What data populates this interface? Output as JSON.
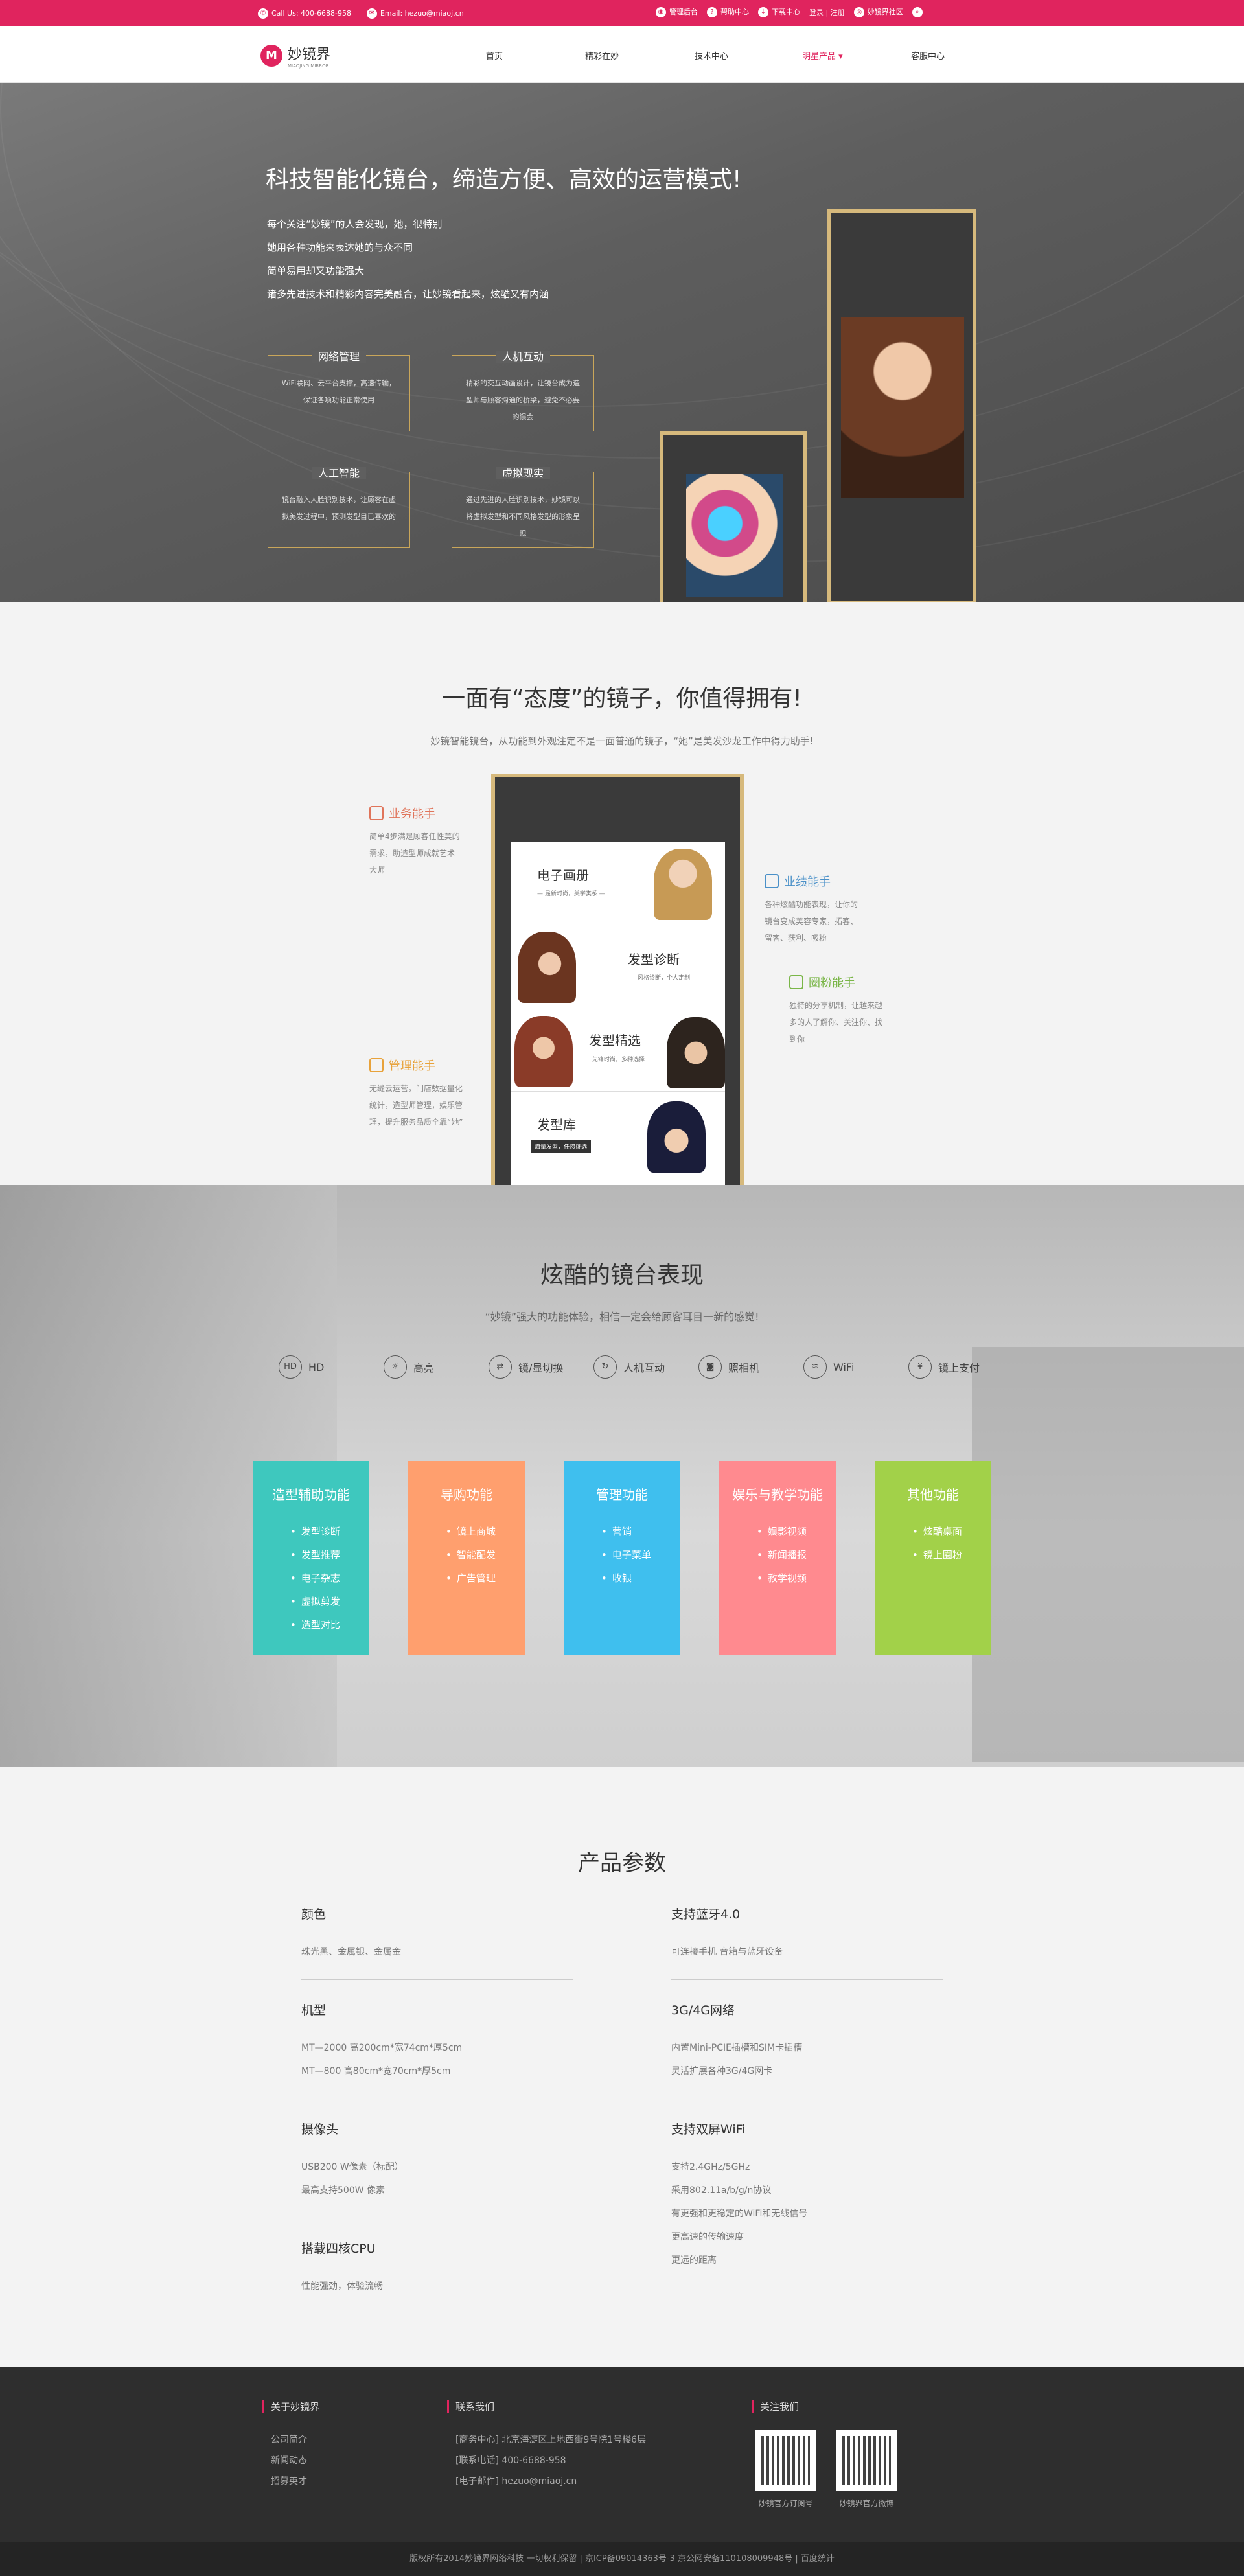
{
  "topbar": {
    "tel": "Call Us: 400-6688-958",
    "email": "Email: hezuo@miaoj.cn",
    "links": [
      "管理后台",
      "帮助中心",
      "下载中心",
      "登录 | 注册",
      "妙镜界社区"
    ],
    "search_icon": "search-icon"
  },
  "nav": {
    "logo_name": "妙镜界",
    "logo_sub": "MIAOJING MIRROR",
    "items": [
      "首页",
      "精彩在妙",
      "技术中心",
      "明星产品 ▾",
      "客服中心"
    ]
  },
  "hero": {
    "title": "科技智能化镜台，缔造方便、高效的运营模式!",
    "desc": [
      "每个关注“妙镜”的人会发现，她，很特别",
      "她用各种功能来表达她的与众不同",
      "简单易用却又功能强大",
      "诸多先进技术和精彩内容完美融合，让妙镜看起来，炫酷又有内涵"
    ],
    "boxes": [
      {
        "title": "网络管理",
        "text": "WiFi联网、云平台支撑，高速传输，保证各项功能正常使用"
      },
      {
        "title": "人机互动",
        "text": "精彩的交互动画设计，让镜台成为造型师与顾客沟通的桥梁，避免不必要的误会"
      },
      {
        "title": "人工智能",
        "text": "镜台融入人脸识别技术，让顾客在虚拟美发过程中，预测发型目已喜欢的"
      },
      {
        "title": "虚拟现实",
        "text": "通过先进的人脸识别技术，妙镜可以将虚拟发型和不同风格发型的形象呈现"
      }
    ]
  },
  "sec2": {
    "title": "一面有“态度”的镜子，你值得拥有!",
    "sub": "妙镜智能镜台，从功能到外观注定不是一面普通的镜子，“她”是美发沙龙工作中得力助手!",
    "panels": [
      {
        "title": "电子画册",
        "sub": "— 最新时尚，美学类系 —"
      },
      {
        "title": "发型诊断",
        "sub": "风格诊断，个人定制"
      },
      {
        "title": "发型精选",
        "sub": "先锋时尚，多种选择"
      },
      {
        "title": "发型库",
        "sub": "海量发型，任您挑选"
      }
    ],
    "features": [
      {
        "title": "业务能手",
        "text": "简单4步满足顾客任性美的需求，助造型师成就艺术大师",
        "color": "#e0745a"
      },
      {
        "title": "业绩能手",
        "text": "各种炫酷功能表现，让你的镜台变成美容专家，拓客、留客、获利、吸粉",
        "color": "#4a90c8"
      },
      {
        "title": "圈粉能手",
        "text": "独特的分享机制，让越来越多的人了解你、关注你、找到你",
        "color": "#7ab648"
      },
      {
        "title": "管理能手",
        "text": "无缝云运营，门店数据量化统计，造型师管理，娱乐管理，提升服务品质全靠“她”",
        "color": "#e8a23a"
      }
    ]
  },
  "sec3": {
    "title": "炫酷的镜台表现",
    "sub": "“妙镜”强大的功能体验，相信一定会给顾客耳目一新的感觉!",
    "icons": [
      {
        "glyph": "HD",
        "label": "HD",
        "name": "hd-icon"
      },
      {
        "glyph": "☼",
        "label": "高亮",
        "name": "brightness-icon"
      },
      {
        "glyph": "⇄",
        "label": "镜/显切换",
        "name": "switch-icon"
      },
      {
        "glyph": "↻",
        "label": "人机互动",
        "name": "interaction-icon"
      },
      {
        "glyph": "◙",
        "label": "照相机",
        "name": "camera-icon"
      },
      {
        "glyph": "≋",
        "label": "WiFi",
        "name": "wifi-icon"
      },
      {
        "glyph": "¥",
        "label": "镜上支付",
        "name": "payment-icon"
      }
    ],
    "cards": [
      {
        "title": "造型辅助功能",
        "color": "#3ec8be",
        "items": [
          "发型诊断",
          "发型推荐",
          "电子杂志",
          "虚拟剪发",
          "造型对比"
        ]
      },
      {
        "title": "导购功能",
        "color": "#ff9f6e",
        "items": [
          "镜上商城",
          "智能配发",
          "广告管理"
        ]
      },
      {
        "title": "管理功能",
        "color": "#3fbfee",
        "items": [
          "营销",
          "电子菜单",
          "收银"
        ]
      },
      {
        "title": "娱乐与教学功能",
        "color": "#ff8a8f",
        "items": [
          "娱影视频",
          "新闻播报",
          "教学视频"
        ]
      },
      {
        "title": "其他功能",
        "color": "#a2d149",
        "items": [
          "炫酷桌面",
          "镜上圈粉"
        ]
      }
    ]
  },
  "sec4": {
    "title": "产品参数",
    "left": [
      {
        "h": "颜色",
        "v": [
          "珠光黑、金属银、金属金"
        ]
      },
      {
        "h": "机型",
        "v": [
          "MT—2000    高200cm*宽74cm*厚5cm",
          "MT—800    高80cm*宽70cm*厚5cm"
        ]
      },
      {
        "h": "摄像头",
        "v": [
          "USB200 W像素（标配）",
          "最高支持500W 像素"
        ]
      },
      {
        "h": "搭载四核CPU",
        "v": [
          "性能强劲，体验流畅"
        ]
      }
    ],
    "right": [
      {
        "h": "支持蓝牙4.0",
        "v": [
          "可连接手机 音箱与蓝牙设备"
        ]
      },
      {
        "h": "3G/4G网络",
        "v": [
          "内置Mini-PCIE插槽和SIM卡插槽",
          "灵活扩展各种3G/4G网卡"
        ]
      },
      {
        "h": "支持双屏WiFi",
        "v": [
          "支持2.4GHz/5GHz",
          "采用802.11a/b/g/n协议",
          "有更强和更稳定的WiFi和无线信号",
          "更高速的传输速度",
          "更远的距离"
        ]
      }
    ]
  },
  "footer": {
    "about_title": "关于妙镜界",
    "about_items": [
      "公司简介",
      "新闻动态",
      "招募英才"
    ],
    "contact_title": "联系我们",
    "contact_items": [
      "[商务中心] 北京海淀区上地西街9号院1号楼6层",
      "[联系电话] 400-6688-958",
      "[电子邮件] hezuo@miaoj.cn"
    ],
    "follow_title": "关注我们",
    "qr_labels": [
      "妙镜官方订阅号",
      "妙镜界官方微博"
    ],
    "copyright": "版权所有2014妙镜界网络科技 一切权利保留 | 京ICP备09014363号-3 京公网安备110108009948号 | 百度统计"
  }
}
